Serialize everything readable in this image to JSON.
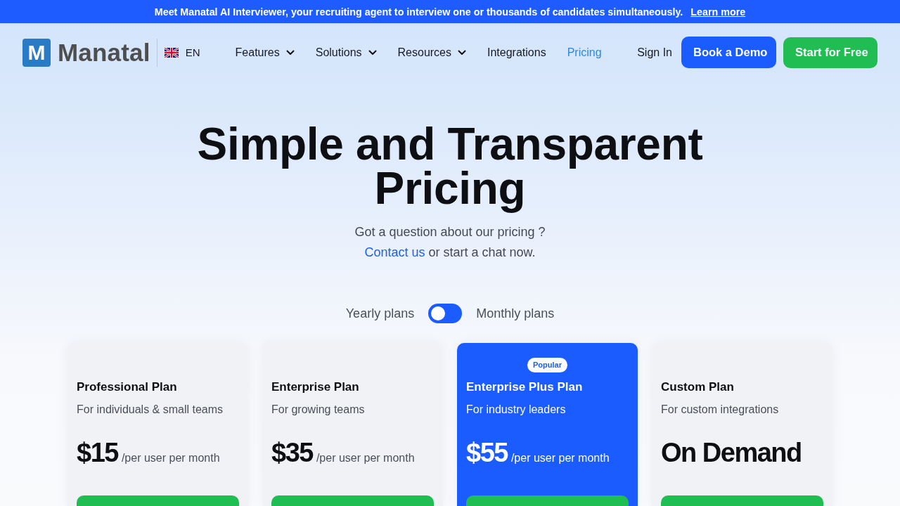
{
  "announcement": {
    "text": "Meet Manatal AI Interviewer, your recruiting agent to interview one or thousands of candidates simultaneously.",
    "link": "Learn more"
  },
  "nav": {
    "logo_mark": "M",
    "logo_text": "Manatal",
    "language": "EN",
    "items": [
      {
        "label": "Features",
        "dropdown": true,
        "selected": false
      },
      {
        "label": "Solutions",
        "dropdown": true,
        "selected": false
      },
      {
        "label": "Resources",
        "dropdown": true,
        "selected": false
      },
      {
        "label": "Integrations",
        "dropdown": false,
        "selected": false
      },
      {
        "label": "Pricing",
        "dropdown": false,
        "selected": true
      }
    ],
    "sign_in": "Sign In",
    "buttons": [
      {
        "label": "Book a Demo",
        "kind": "primary"
      },
      {
        "label": "Start for Free",
        "kind": "success"
      }
    ]
  },
  "hero": {
    "title": "Simple and Transparent Pricing",
    "question": "Got a question about our pricing ?",
    "contact_link": "Contact us",
    "contact_rest": "or start a chat now."
  },
  "billing": {
    "left_label": "Yearly plans",
    "right_label": "Monthly plans",
    "on": false
  },
  "plans": [
    {
      "name": "Professional Plan",
      "tagline": "For individuals & small teams",
      "price": "$15",
      "unit": "/per user per month",
      "popular": false
    },
    {
      "name": "Enterprise Plan",
      "tagline": "For growing teams",
      "price": "$35",
      "unit": "/per user per month",
      "popular": false
    },
    {
      "name": "Enterprise Plus Plan",
      "tagline": "For industry leaders",
      "price": "$55",
      "unit": "/per user per month",
      "popular": true,
      "badge": "Popular"
    },
    {
      "name": "Custom Plan",
      "tagline": "For custom integrations",
      "price": "On Demand",
      "popular": false
    }
  ]
}
